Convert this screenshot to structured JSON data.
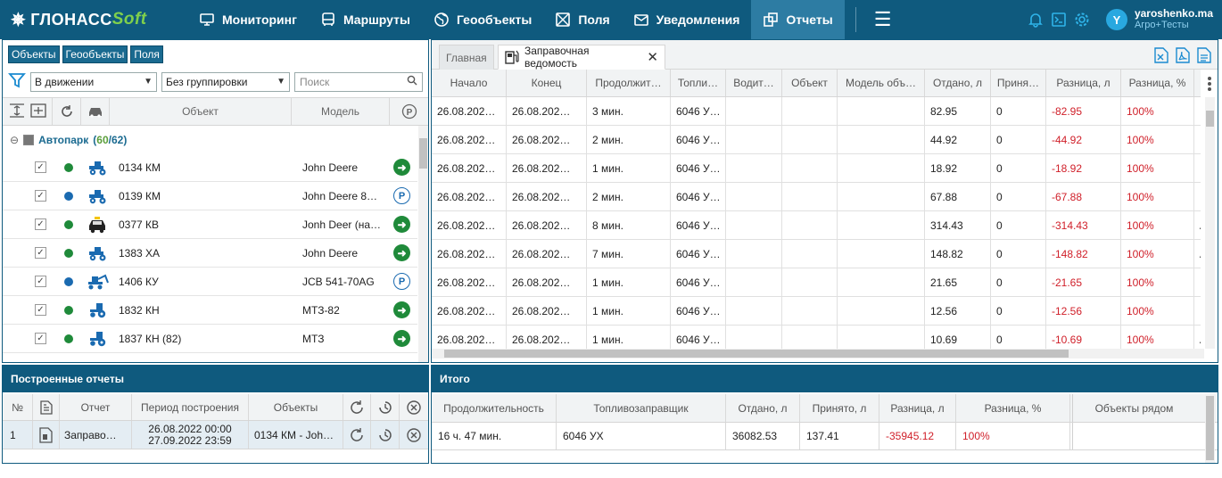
{
  "brand": {
    "name": "ГЛОНАСС",
    "suffix": "Soft"
  },
  "nav": [
    {
      "label": "Мониторинг",
      "icon": "monitor-icon"
    },
    {
      "label": "Маршруты",
      "icon": "bus-icon"
    },
    {
      "label": "Геообъекты",
      "icon": "globe-icon"
    },
    {
      "label": "Поля",
      "icon": "field-icon"
    },
    {
      "label": "Уведомления",
      "icon": "mail-icon"
    },
    {
      "label": "Отчеты",
      "icon": "reports-icon",
      "active": true
    }
  ],
  "user": {
    "initial": "Y",
    "name": "yaroshenko.ma",
    "org": "Агро+Тесты"
  },
  "left": {
    "pills": [
      "Объекты",
      "Геообъекты",
      "Поля"
    ],
    "filter_motion": "В движении",
    "filter_group": "Без группировки",
    "search_placeholder": "Поиск",
    "col_object": "Объект",
    "col_model": "Модель",
    "group_name": "Автопарк",
    "group_active": "60",
    "group_total": "62",
    "objects": [
      {
        "name": "0134 КМ",
        "model": "John Deere",
        "dot": "#1f8a3a",
        "status": "go",
        "vehicle": "tractor"
      },
      {
        "name": "0139 КМ",
        "model": "John Deere 8…",
        "dot": "#1a6ab0",
        "status": "park",
        "vehicle": "tractor"
      },
      {
        "name": "0377 КВ",
        "model": "Jonh Deer (на…",
        "dot": "#1f8a3a",
        "status": "go",
        "vehicle": "car"
      },
      {
        "name": "1383 ХА",
        "model": "John Deere",
        "dot": "#1f8a3a",
        "status": "go",
        "vehicle": "tractor"
      },
      {
        "name": "1406 КУ",
        "model": "JCB 541-70AG",
        "dot": "#1a6ab0",
        "status": "park",
        "vehicle": "loader"
      },
      {
        "name": "1832 КН",
        "model": "МТЗ-82",
        "dot": "#1f8a3a",
        "status": "go",
        "vehicle": "tractor2"
      },
      {
        "name": "1837 КН (82)",
        "model": "МТЗ",
        "dot": "#1f8a3a",
        "status": "go",
        "vehicle": "tractor2"
      }
    ]
  },
  "built": {
    "title": "Построенные отчеты",
    "headers": {
      "num": "№",
      "report": "Отчет",
      "period": "Период построения",
      "objects": "Объекты"
    },
    "row": {
      "num": "1",
      "report": "Заправо…",
      "period_from": "26.08.2022 00:00",
      "period_to": "27.09.2022 23:59",
      "objects": "0134 КМ - Joh…"
    }
  },
  "tabs": {
    "home": "Главная",
    "report": "Заправочная ведомость"
  },
  "table": {
    "headers": [
      "Начало",
      "Конец",
      "Продолжит…",
      "Топли…",
      "Водит…",
      "Объект",
      "Модель объ…",
      "Отдано, л",
      "Приня…",
      "Разница, л",
      "Разница, %"
    ],
    "rows": [
      {
        "start": "26.08.202…",
        "end": "26.08.202…",
        "dur": "3 мин.",
        "fuel": "6046 У…",
        "given": "82.95",
        "taken": "0",
        "diff": "-82.95",
        "pct": "100%",
        "extra": ""
      },
      {
        "start": "26.08.202…",
        "end": "26.08.202…",
        "dur": "2 мин.",
        "fuel": "6046 У…",
        "given": "44.92",
        "taken": "0",
        "diff": "-44.92",
        "pct": "100%",
        "extra": ""
      },
      {
        "start": "26.08.202…",
        "end": "26.08.202…",
        "dur": "1 мин.",
        "fuel": "6046 У…",
        "given": "18.92",
        "taken": "0",
        "diff": "-18.92",
        "pct": "100%",
        "extra": ""
      },
      {
        "start": "26.08.202…",
        "end": "26.08.202…",
        "dur": "2 мин.",
        "fuel": "6046 У…",
        "given": "67.88",
        "taken": "0",
        "diff": "-67.88",
        "pct": "100%",
        "extra": ""
      },
      {
        "start": "26.08.202…",
        "end": "26.08.202…",
        "dur": "8 мин.",
        "fuel": "6046 У…",
        "given": "314.43",
        "taken": "0",
        "diff": "-314.43",
        "pct": "100%",
        "extra": "А"
      },
      {
        "start": "26.08.202…",
        "end": "26.08.202…",
        "dur": "7 мин.",
        "fuel": "6046 У…",
        "given": "148.82",
        "taken": "0",
        "diff": "-148.82",
        "pct": "100%",
        "extra": "А"
      },
      {
        "start": "26.08.202…",
        "end": "26.08.202…",
        "dur": "1 мин.",
        "fuel": "6046 У…",
        "given": "21.65",
        "taken": "0",
        "diff": "-21.65",
        "pct": "100%",
        "extra": ""
      },
      {
        "start": "26.08.202…",
        "end": "26.08.202…",
        "dur": "1 мин.",
        "fuel": "6046 У…",
        "given": "12.56",
        "taken": "0",
        "diff": "-12.56",
        "pct": "100%",
        "extra": ""
      },
      {
        "start": "26.08.202…",
        "end": "26.08.202…",
        "dur": "1 мин.",
        "fuel": "6046 У…",
        "given": "10.69",
        "taken": "0",
        "diff": "-10.69",
        "pct": "100%",
        "extra": "А"
      }
    ]
  },
  "totals": {
    "title": "Итого",
    "headers": [
      "Продолжительность",
      "Топливозаправщик",
      "Отдано, л",
      "Принято, л",
      "Разница, л",
      "Разница, %",
      "Объекты рядом"
    ],
    "values": {
      "dur": "16 ч. 47 мин.",
      "tanker": "6046 УХ",
      "given": "36082.53",
      "taken": "137.41",
      "diff": "-35945.12",
      "pct": "100%",
      "near": ""
    }
  }
}
